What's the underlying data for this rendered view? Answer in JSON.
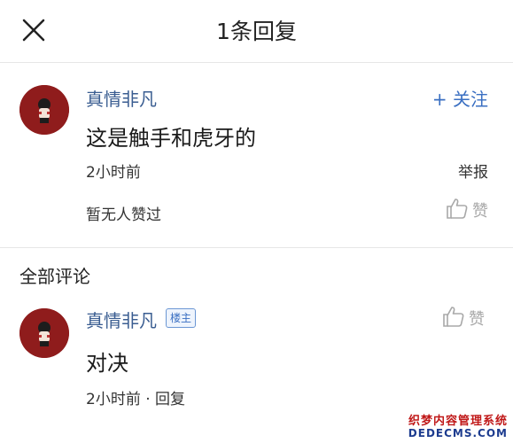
{
  "header": {
    "title": "1条回复"
  },
  "main_post": {
    "username": "真情非凡",
    "follow_label": "+ 关注",
    "content": "这是触手和虎牙的",
    "time": "2小时前",
    "report_label": "举报",
    "no_likes_text": "暂无人赞过",
    "like_label": "赞"
  },
  "comments_section": {
    "title": "全部评论",
    "comments": [
      {
        "username": "真情非凡",
        "badge": "楼主",
        "content": "对决",
        "time": "2小时前",
        "separator": "·",
        "reply_label": "回复",
        "like_label": "赞"
      }
    ]
  },
  "watermark": {
    "line1": "织梦内容管理系统",
    "line2": "DEDECMS.COM"
  },
  "colors": {
    "username": "#3a5d91",
    "follow": "#3a6fc2",
    "avatar_bg": "#8f1c1c",
    "like_gray": "#a8a8a8"
  }
}
